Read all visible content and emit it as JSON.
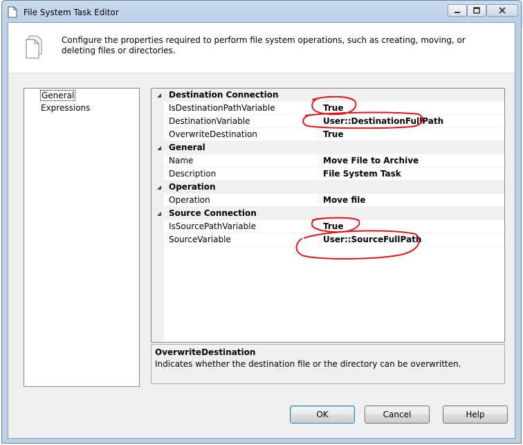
{
  "window": {
    "title": "File System Task Editor"
  },
  "header": {
    "description": "Configure the properties required to perform file system operations, such as creating, moving, or deleting files or directories."
  },
  "nav": {
    "items": [
      {
        "label": "General",
        "selected": true
      },
      {
        "label": "Expressions",
        "selected": false
      }
    ]
  },
  "grid": {
    "rows": [
      {
        "kind": "category",
        "label": "Destination Connection"
      },
      {
        "kind": "property",
        "name": "IsDestinationPathVariable",
        "value": "True"
      },
      {
        "kind": "property",
        "name": "DestinationVariable",
        "value": "User::DestinationFullPath"
      },
      {
        "kind": "property",
        "name": "OverwriteDestination",
        "value": "True"
      },
      {
        "kind": "category",
        "label": "General"
      },
      {
        "kind": "property",
        "name": "Name",
        "value": "Move File to Archive"
      },
      {
        "kind": "property",
        "name": "Description",
        "value": "File System Task"
      },
      {
        "kind": "category",
        "label": "Operation"
      },
      {
        "kind": "property",
        "name": "Operation",
        "value": "Move file"
      },
      {
        "kind": "category",
        "label": "Source Connection"
      },
      {
        "kind": "property",
        "name": "IsSourcePathVariable",
        "value": "True"
      },
      {
        "kind": "property",
        "name": "SourceVariable",
        "value": "User::SourceFullPath"
      }
    ]
  },
  "description_panel": {
    "title": "OverwriteDestination",
    "text": "Indicates whether the destination file or the directory can be overwritten."
  },
  "buttons": {
    "ok": "OK",
    "cancel": "Cancel",
    "help": "Help"
  },
  "colors": {
    "annotation": "#e0141b",
    "category_bg": "#f0f0f0"
  }
}
